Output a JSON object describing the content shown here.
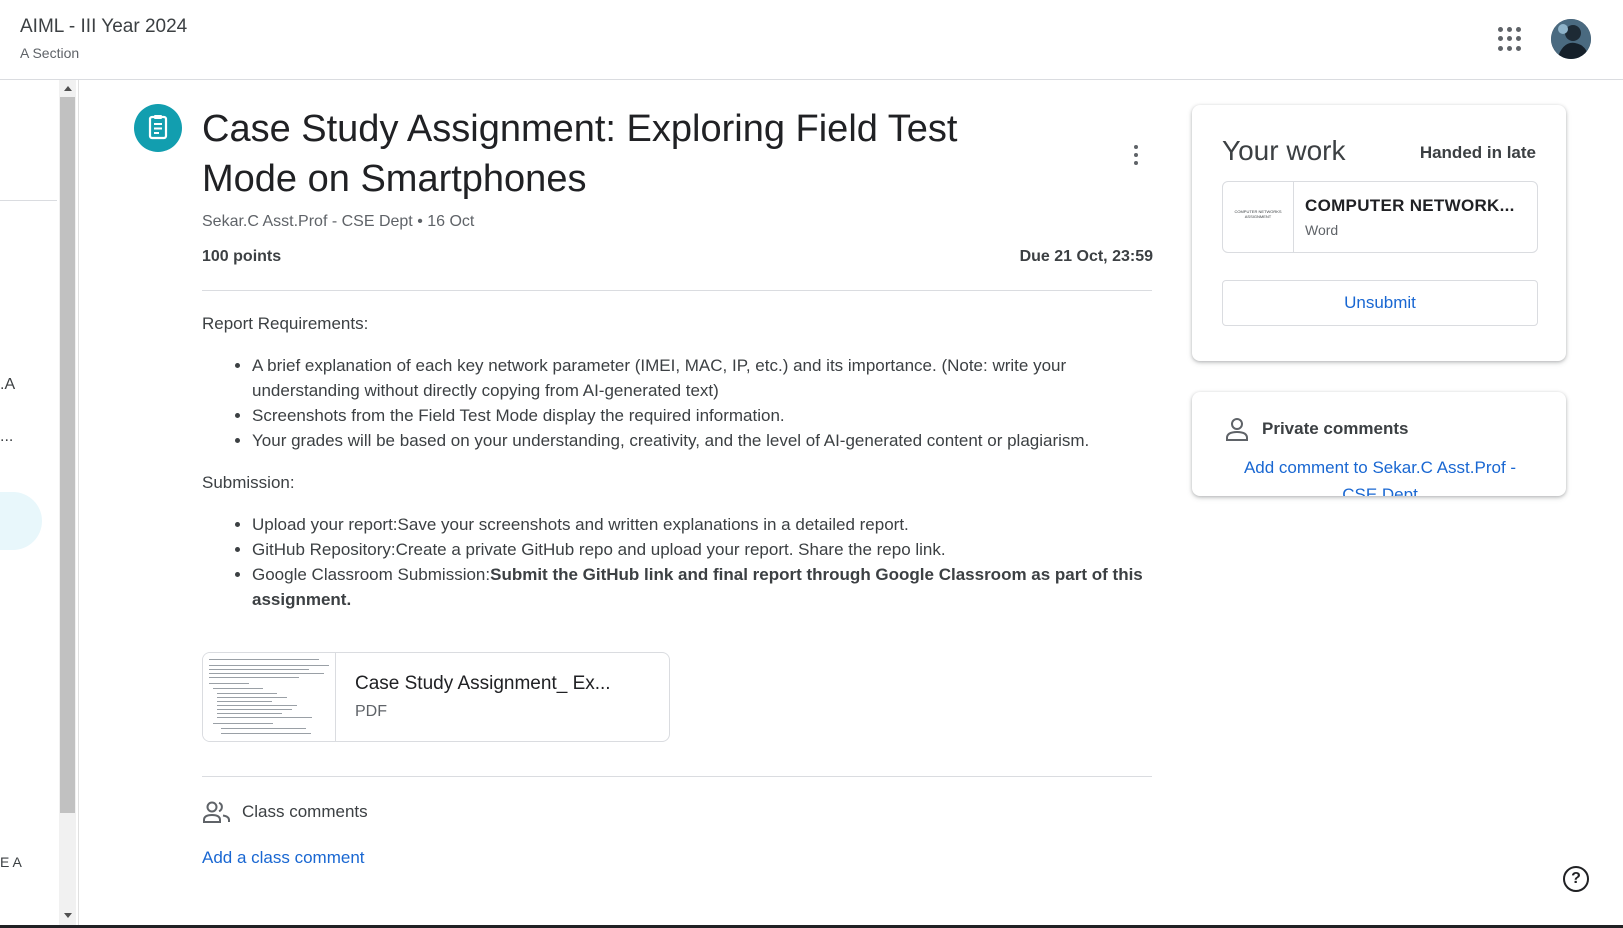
{
  "header": {
    "class_title": "AIML - III Year 2024",
    "class_section": "A Section"
  },
  "sidebar": {
    "partial_texts": [
      ".A",
      "...",
      "E A"
    ]
  },
  "assignment": {
    "title": "Case Study Assignment: Exploring Field Test Mode on Smartphones",
    "meta": "Sekar.C Asst.Prof - CSE Dept • 16 Oct",
    "points": "100 points",
    "due": "Due 21 Oct, 23:59",
    "report_heading": "Report Requirements:",
    "report_items": [
      "A brief explanation of each key network parameter (IMEI, MAC, IP, etc.) and its importance. (Note: write your understanding without directly copying from AI-generated text)",
      "Screenshots from the Field Test Mode display the required information.",
      "Your grades will be based on your understanding, creativity, and the level of AI-generated content or plagiarism."
    ],
    "submission_heading": "Submission:",
    "submission_items": [
      {
        "text": "Upload your report:Save your screenshots and written explanations in a detailed report.",
        "bold": ""
      },
      {
        "text": "GitHub Repository:Create a private GitHub repo and upload your report. Share the repo link.",
        "bold": ""
      },
      {
        "text": "Google Classroom Submission:",
        "bold": "Submit the GitHub link and final report through Google Classroom as part of this assignment."
      }
    ],
    "attachment": {
      "title": "Case Study Assignment_ Ex...",
      "type": "PDF"
    },
    "class_comments_label": "Class comments",
    "add_class_comment": "Add a class comment"
  },
  "your_work": {
    "title": "Your work",
    "status": "Handed in late",
    "file": {
      "thumb_text": "COMPUTER NETWORKS ASSIGNMENT",
      "name": "COMPUTER NETWORK...",
      "type": "Word"
    },
    "unsubmit_label": "Unsubmit"
  },
  "private_comments": {
    "label": "Private comments",
    "add": "Add comment to Sekar.C Asst.Prof - CSE Dept"
  },
  "colors": {
    "accent": "#129eaf",
    "link": "#1967d2"
  },
  "icons": [
    "assignment-icon",
    "more-vert-icon",
    "apps-grid-icon",
    "avatar",
    "people-icon",
    "person-icon",
    "help-icon"
  ]
}
